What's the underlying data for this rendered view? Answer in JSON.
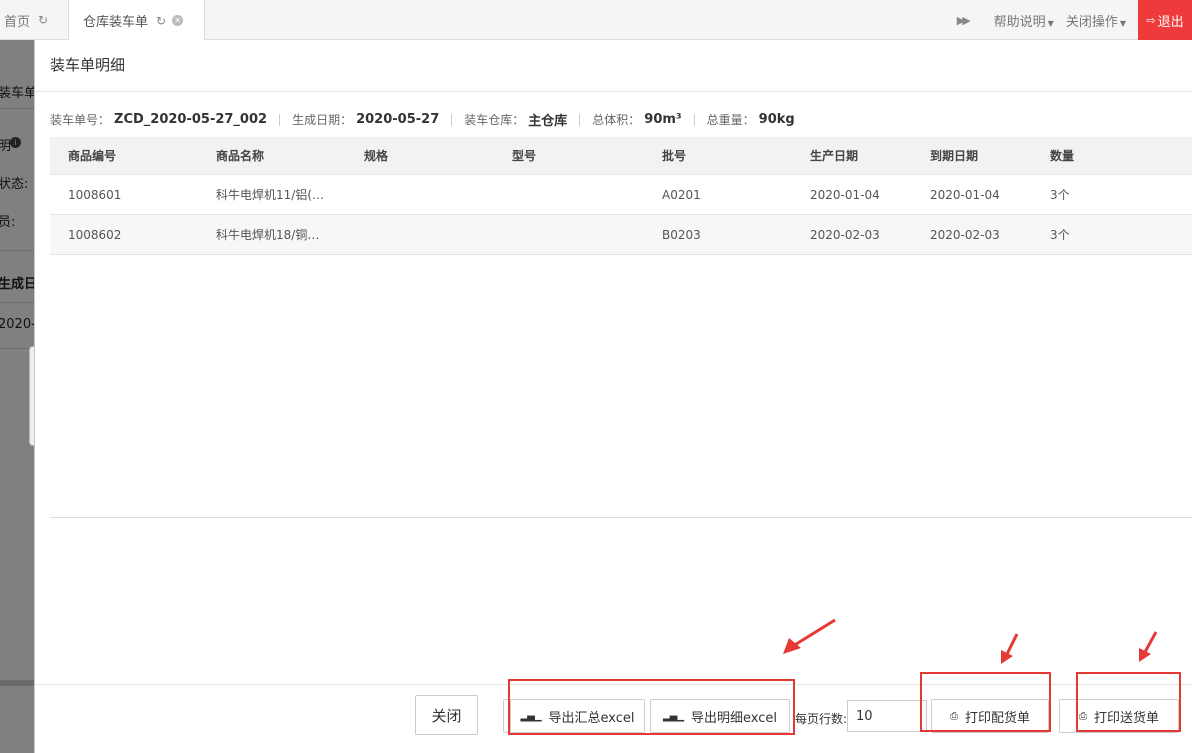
{
  "tabs": {
    "home": "首页",
    "active": "仓库装车单"
  },
  "topbar": {
    "help": "帮助说明",
    "close_ops": "关闭操作",
    "logout": "退出"
  },
  "background_page": {
    "fragments": [
      "装车单",
      "明",
      "状态:",
      "员:",
      "生成日",
      "2020-"
    ]
  },
  "modal": {
    "title": "装车单明细",
    "summary": [
      {
        "label": "装车单号：",
        "value": "ZCD_2020-05-27_002"
      },
      {
        "label": "生成日期：",
        "value": "2020-05-27"
      },
      {
        "label": "装车仓库：",
        "value": "主仓库"
      },
      {
        "label": "总体积：",
        "value": "90m³"
      },
      {
        "label": "总重量：",
        "value": "90kg"
      }
    ],
    "columns": [
      "商品编号",
      "商品名称",
      "规格",
      "型号",
      "批号",
      "生产日期",
      "到期日期",
      "数量"
    ],
    "rows": [
      [
        "1008601",
        "科牛电焊机11/铝(…",
        "",
        "",
        "A0201",
        "2020-01-04",
        "2020-01-04",
        "3个"
      ],
      [
        "1008602",
        "科牛电焊机18/铜…",
        "",
        "",
        "B0203",
        "2020-02-03",
        "2020-02-03",
        "3个"
      ]
    ],
    "footer": {
      "close": "关闭",
      "export_summary": "导出汇总excel",
      "export_detail": "导出明细excel",
      "page_size_label": "每页行数:",
      "page_size_value": "10",
      "print_picking": "打印配货单",
      "print_delivery": "打印送货单"
    }
  },
  "annotation_color": "#e53935"
}
